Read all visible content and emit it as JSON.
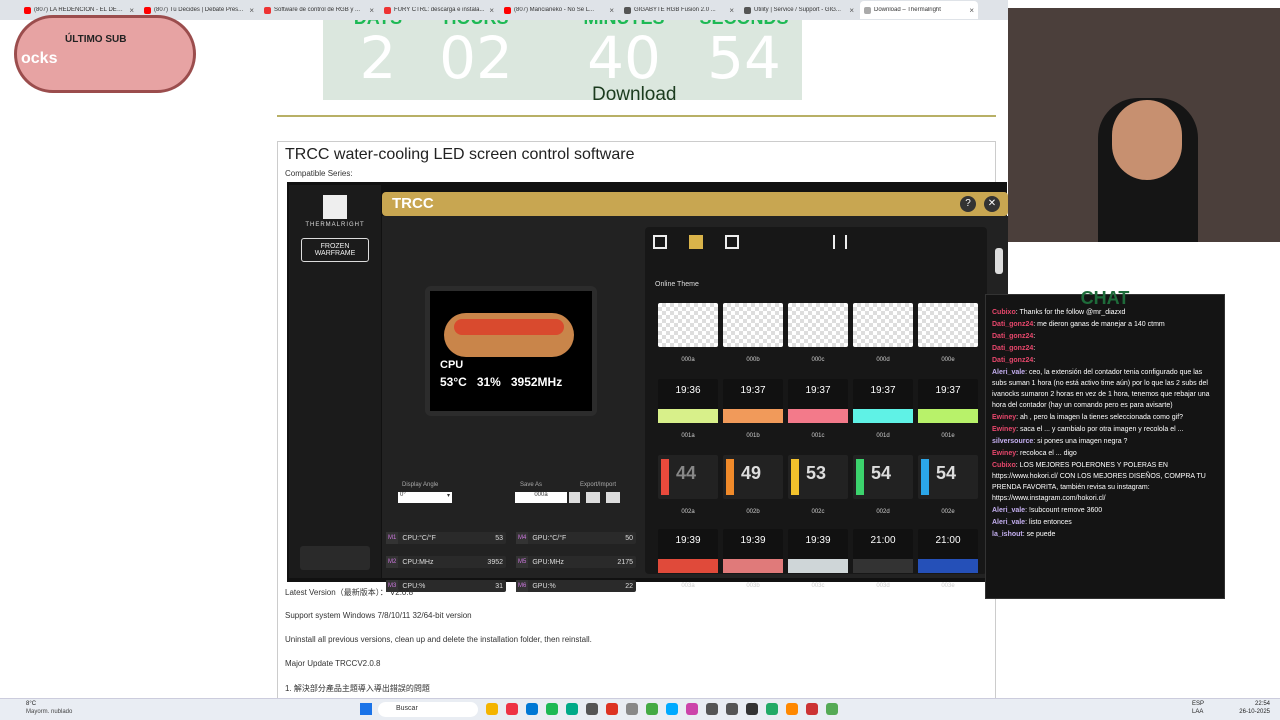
{
  "tabs": [
    {
      "label": "(807) LA REDENCION - EL DETE...",
      "color": "#ff0000"
    },
    {
      "label": "(807) Tú Decides | Debate Pres...",
      "color": "#ff0000"
    },
    {
      "label": "Software de control de RGB y ...",
      "color": "#e33"
    },
    {
      "label": "FURY CTRL: descarga e instala...",
      "color": "#e33"
    },
    {
      "label": "(807) Mancianeko - No Se L...",
      "color": "#ff0000"
    },
    {
      "label": "GIGABYTE RGB Fusion 2.0 ...",
      "color": "#555"
    },
    {
      "label": "Utility | Service / Support - GIG...",
      "color": "#555"
    },
    {
      "label": "Download – Thermalright",
      "color": "#aaa"
    }
  ],
  "sub_overlay": {
    "title": "ÚLTIMO SUB",
    "name": "ocks"
  },
  "countdown": {
    "labels": [
      "DAYS",
      "HOURS",
      "MINUTES",
      "SECONDS"
    ],
    "values": [
      "2",
      "02",
      "40",
      "54"
    ],
    "download": "Download"
  },
  "section": {
    "title": "TRCC water-cooling LED screen control software",
    "compat": "Compatible Series:"
  },
  "trcc": {
    "title": "TRCC",
    "brand": "THERMALRIGHT",
    "product": "FROZEN WARFRAME",
    "preview": {
      "label": "CPU",
      "temp": "53°C",
      "usage": "31%",
      "freq": "3952MHz"
    },
    "display_angle_label": "Display Angle",
    "display_angle": "0°",
    "save_as_label": "Save As",
    "save_as": "000a",
    "export_label": "Export/Import",
    "online_theme": "Online Theme",
    "metrics": [
      {
        "id": "M1",
        "name": "CPU:°C/°F",
        "value": "53"
      },
      {
        "id": "M2",
        "name": "CPU:MHz",
        "value": "3952"
      },
      {
        "id": "M3",
        "name": "CPU:%",
        "value": "31"
      },
      {
        "id": "M4",
        "name": "GPU:°C/°F",
        "value": "50"
      },
      {
        "id": "M5",
        "name": "GPU:MHz",
        "value": "2175"
      },
      {
        "id": "M6",
        "name": "GPU:%",
        "value": "22"
      }
    ],
    "themes": [
      [
        "000a",
        "000b",
        "000c",
        "000d",
        "000e"
      ],
      [
        "001a",
        "001b",
        "001c",
        "001d",
        "001e"
      ],
      [
        "002a",
        "002b",
        "002c",
        "002d",
        "002e"
      ],
      [
        "003a",
        "003b",
        "003c",
        "003d",
        "003e"
      ]
    ],
    "row1_time": [
      "19:36",
      "19:37",
      "19:37",
      "19:37",
      "19:37"
    ],
    "row2_nums": [
      "44",
      "49",
      "53",
      "54",
      "54"
    ],
    "row3_time": [
      "19:39",
      "19:39",
      "19:39",
      "21:00",
      "21:00"
    ],
    "row_colors": [
      "#e84a3c",
      "#f08a2a",
      "#f3c22c",
      "#3cd36d",
      "#2ba6e8"
    ]
  },
  "info": [
    "Latest Version（最新版本）： V2.0.8",
    "Support system Windows 7/8/10/11 32/64-bit version",
    "Uninstall all previous versions, clean up and delete the installation folder, then reinstall.",
    "Major Update TRCCV2.0.8",
    "1. 解決部分產品主題導入導出錯誤的問題"
  ],
  "chat": {
    "title": "CHAT",
    "messages": [
      {
        "user": "Cubixo",
        "text": ": Thanks for the follow @mr_diazxd"
      },
      {
        "user": "Dati_gonz24",
        "text": ": me dieron ganas de manejar a 140 ctmm"
      },
      {
        "user": "Dati_gonz24",
        "text": ":"
      },
      {
        "user": "Dati_gonz24",
        "text": ":"
      },
      {
        "user": "Dati_gonz24",
        "text": ":"
      },
      {
        "user": "Aleri_vale",
        "text": ": ceo, la extensión del contador tenia configurado que las subs suman 1 hora (no está activo time aún) por lo que las 2 subs del ivanocks sumaron 2 horas en vez de 1 hora, tenemos que rebajar una hora del contador (hay un comando pero es para avisarte)"
      },
      {
        "user": "Ewiney",
        "text": ": ah , pero la imagen la tienes seleccionada como gif?"
      },
      {
        "user": "Ewiney",
        "text": ": saca el ... y cambialo por otra imagen y recolola el ..."
      },
      {
        "user": "silversource",
        "text": ": si pones una imagen negra ?"
      },
      {
        "user": "Ewiney",
        "text": ": recoloca el ... digo"
      },
      {
        "user": "Cubixo",
        "text": ": LOS MEJORES POLERONES Y POLERAS EN https://www.hokori.cl/ CON LOS MEJORES DISEÑOS, COMPRA TU PRENDA FAVORITA, también revisa su instagram: https://www.instagram.com/hokori.cl/"
      },
      {
        "user": "Aleri_vale",
        "text": ": !subcount remove 3600"
      },
      {
        "user": "Aleri_vale",
        "text": ": listo entonces"
      },
      {
        "user": "la_ishout",
        "text": ": se puede"
      }
    ]
  },
  "taskbar": {
    "weather_temp": "8°C",
    "weather_desc": "Mayorm. nublado",
    "search": "Buscar",
    "lang1": "ESP",
    "lang2": "LAA",
    "time": "22:54",
    "date": "26-10-2025"
  }
}
